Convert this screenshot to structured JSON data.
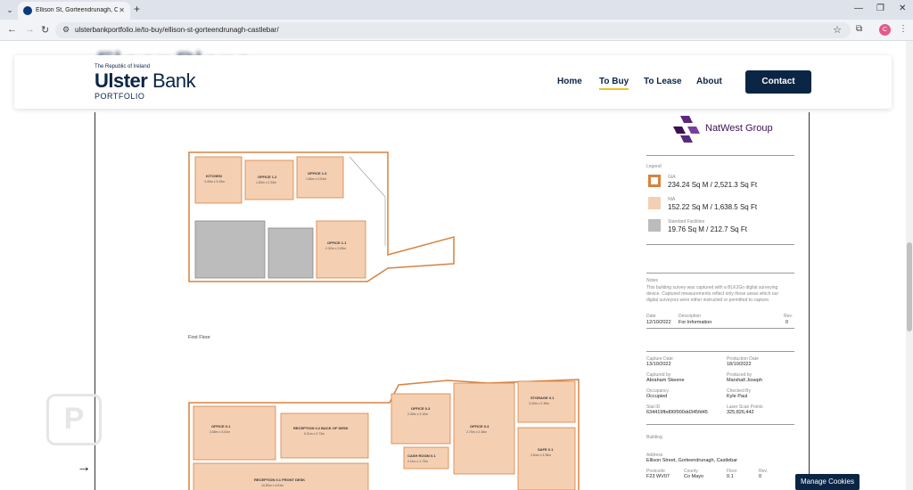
{
  "browser": {
    "tab_title": "Ellison St, Gorteendrunagh, Castlebar",
    "url": "ulsterbankportfolio.ie/to-buy/ellison-st-gorteendrunagh-castlebar/",
    "profile_initial": "C"
  },
  "header": {
    "logo_small": "The Republic of Ireland",
    "logo_ulster": "Ulster",
    "logo_bank": "Bank",
    "logo_portfolio": "PORTFOLIO",
    "background_heading": "Floor Plans",
    "nav": [
      "Home",
      "To Buy",
      "To Lease",
      "About"
    ],
    "contact_label": "Contact"
  },
  "plan": {
    "brand": "NatWest Group",
    "legend_title": "Legend",
    "legend": [
      {
        "label": "GIA",
        "value": "234.24 Sq M / 2,521.3 Sq Ft"
      },
      {
        "label": "NIA",
        "value": "152.22 Sq M / 1,638.5 Sq Ft"
      },
      {
        "label": "Standard Facilities",
        "value": "19.76 Sq M / 212.7 Sq Ft"
      }
    ],
    "notes_title": "Notes",
    "notes_text": "This building survey was captured with a BLK2Go digital surveying device. Captured measurements reflect only those areas which our digital surveyors were either instructed or permitted to capture.",
    "revision": {
      "date_label": "Date",
      "desc_label": "Description",
      "rev_label": "Rev.",
      "date": "12/10/2022",
      "desc": "For Information",
      "rev": "0"
    },
    "capture_date_label": "Capture Date",
    "capture_date": "13/10/2022",
    "production_date_label": "Production Date",
    "production_date": "18/10/2022",
    "captured_by_label": "Captured by",
    "captured_by": "Abraham Skeene",
    "produced_by_label": "Produced by",
    "produced_by": "Marshall Joseph",
    "occupancy_label": "Occupancy",
    "occupancy": "Occupied",
    "checked_by_label": "Checked By",
    "checked_by": "Kyle Paul",
    "stat_id_label": "Stat ID",
    "stat_id": "634419fbd06f900dd345fd45",
    "laser_label": "Laser Scan Points",
    "laser": "325,826,442",
    "building_label": "Building",
    "address_label": "Address",
    "address": "Ellison Street, Gorteendrunagh, Castlebar",
    "postcode_label": "Postcode",
    "postcode": "F23 WV07",
    "county_label": "County",
    "county": "Co Mayo",
    "floor_label": "Floor",
    "floor": "0.1",
    "rev2_label": "Rev.",
    "rev2": "0",
    "first_floor_label": "First Floor",
    "rooms_first": [
      {
        "name": "KITCHEN",
        "dims": "3.40m x 3.33m"
      },
      {
        "name": "OFFICE 1.2",
        "dims": "1.83m x 2.33m"
      },
      {
        "name": "OFFICE 1.3",
        "dims": "1.86m x 2.81m"
      },
      {
        "name": "OFFICE 1.1",
        "dims": "2.32m x 2.83m"
      }
    ],
    "rooms_ground": [
      {
        "name": "OFFICE 0.1",
        "dims": "3.68m x 3.61m"
      },
      {
        "name": "RECEPTION 0.2 BACK OF DESK",
        "dims": "6.31m x 2.73m"
      },
      {
        "name": "OFFICE 0.3",
        "dims": "2.35m x 3.10m"
      },
      {
        "name": "CASH ROOM 0.1",
        "dims": "2.11m x 1.73m"
      },
      {
        "name": "OFFICE 0.3",
        "dims": "2.75m x 2.36m"
      },
      {
        "name": "STORAGE 0.1",
        "dims": "3.43m x 2.35m"
      },
      {
        "name": "SAFE 0.1",
        "dims": "2.84m x 3.38m"
      },
      {
        "name": "RECEPTION 0.1 FRONT DESK",
        "dims": "10.80m x 4.61m"
      }
    ]
  },
  "cookies_label": "Manage Cookies",
  "colors": {
    "navy": "#0b2545",
    "accent": "#e8c32a",
    "gia": "#d7823f",
    "nia": "#f5cfb2",
    "sf": "#bcbcbc"
  }
}
